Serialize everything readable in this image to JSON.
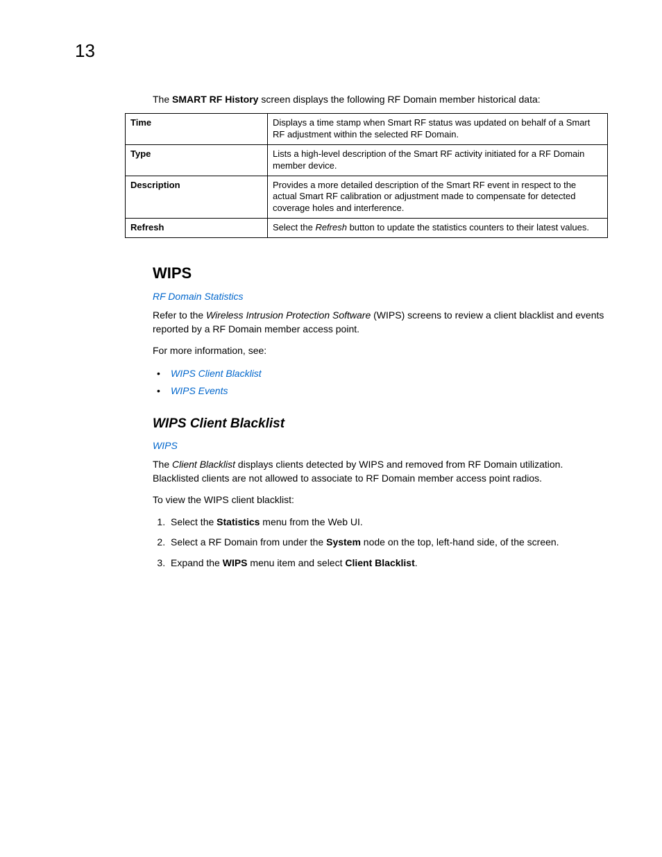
{
  "page_number": "13",
  "intro": {
    "prefix": "The ",
    "bold": "SMART RF History",
    "suffix": " screen displays the following RF Domain member historical data:"
  },
  "table": {
    "rows": [
      {
        "label": "Time",
        "desc": "Displays a time stamp when Smart RF status was updated on behalf of a Smart RF adjustment within the selected RF Domain."
      },
      {
        "label": "Type",
        "desc": "Lists a high-level description of the Smart RF activity initiated for a RF Domain member device."
      },
      {
        "label": "Description",
        "desc": "Provides a more detailed description of the Smart RF event in respect to the actual Smart RF calibration or adjustment made to compensate for detected coverage holes and interference."
      },
      {
        "label": "Refresh",
        "desc_pre": "Select the ",
        "desc_italic": "Refresh",
        "desc_post": " button to update the statistics counters to their latest values."
      }
    ]
  },
  "wips": {
    "heading": "WIPS",
    "breadcrumb": "RF Domain Statistics",
    "para1_pre": "Refer to the ",
    "para1_italic": "Wireless Intrusion Protection Software",
    "para1_post": " (WIPS) screens to review a client blacklist and events reported by a RF Domain member access point.",
    "para2": "For more information, see:",
    "links": [
      "WIPS Client Blacklist",
      "WIPS Events"
    ]
  },
  "blacklist": {
    "heading": "WIPS Client Blacklist",
    "breadcrumb": "WIPS",
    "para1_pre": "The ",
    "para1_italic": "Client Blacklist",
    "para1_post": " displays clients detected by WIPS and removed from RF Domain utilization. Blacklisted clients are not allowed to associate to RF Domain member access point radios.",
    "para2": "To view the WIPS client blacklist:",
    "steps": [
      {
        "pre": "Select the ",
        "b1": "Statistics",
        "mid": " menu from the Web UI.",
        "b2": "",
        "post": ""
      },
      {
        "pre": "Select a RF Domain from under the ",
        "b1": "System",
        "mid": " node on the top, left-hand side, of the screen.",
        "b2": "",
        "post": ""
      },
      {
        "pre": "Expand the ",
        "b1": "WIPS",
        "mid": " menu item and select ",
        "b2": "Client Blacklist",
        "post": "."
      }
    ]
  }
}
